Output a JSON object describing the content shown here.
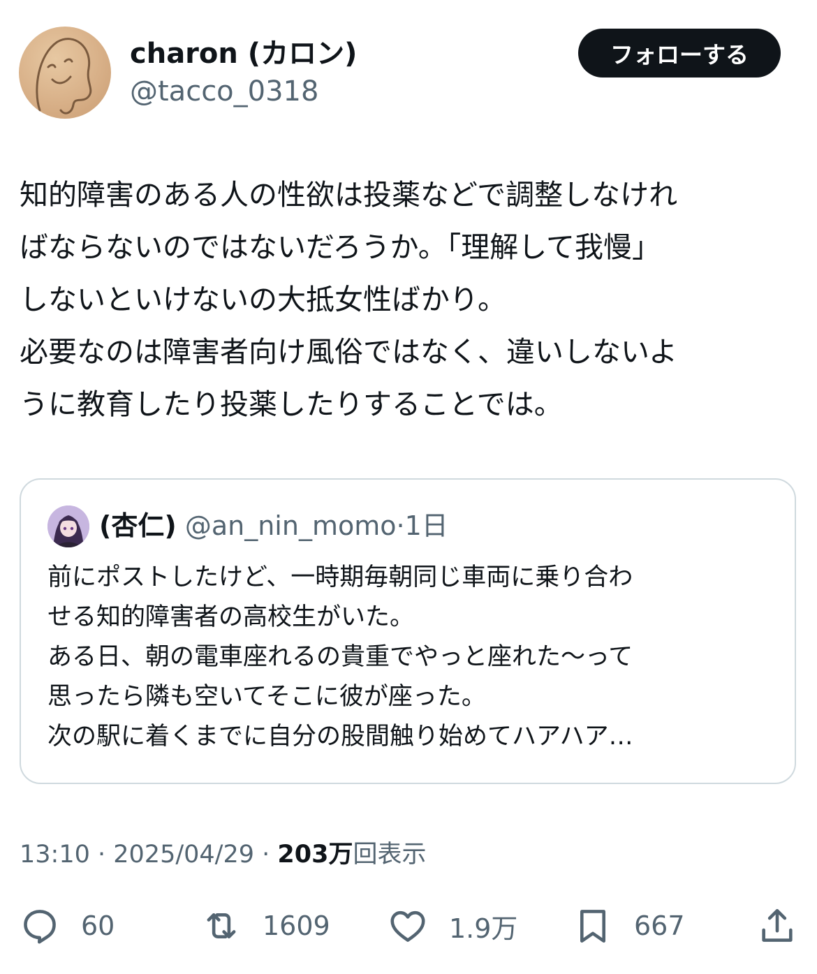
{
  "author": {
    "display_name": "charon (カロン)",
    "handle": "@tacco_0318",
    "avatar_icon": "ghost-drawing-avatar"
  },
  "follow_button": {
    "label": "フォローする"
  },
  "tweet": {
    "lines": [
      "知的障害のある人の性欲は投薬などで調整しなけれ",
      "ばならないのではないだろうか。「理解して我慢」",
      "しないといけないの大抵女性ばかり。",
      "必要なのは障害者向け風俗ではなく、違いしないよ",
      "うに教育したり投薬したりすることでは。"
    ]
  },
  "quote": {
    "name": "(杏仁)",
    "handle": "@an_nin_momo",
    "separator": "·",
    "time": "1日",
    "lines": [
      "前にポストしたけど、一時期毎朝同じ車両に乗り合わ",
      "せる知的障害者の高校生がいた。",
      "ある日、朝の電車座れるの貴重でやっと座れた〜って",
      "思ったら隣も空いてそこに彼が座った。",
      "次の駅に着くまでに自分の股間触り始めてハアハア…"
    ]
  },
  "meta": {
    "time": "13:10",
    "sep1": " · ",
    "date": "2025/04/29",
    "sep2": " · ",
    "views_count": "203万",
    "views_label": "回表示"
  },
  "actions": {
    "reply": {
      "icon": "reply-icon",
      "count": "60"
    },
    "retweet": {
      "icon": "retweet-icon",
      "count": "1609"
    },
    "like": {
      "icon": "heart-icon",
      "count": "1.9万"
    },
    "bookmark": {
      "icon": "bookmark-icon",
      "count": "667"
    },
    "share": {
      "icon": "share-icon"
    }
  },
  "colors": {
    "text": "#0f1419",
    "secondary": "#536471",
    "border": "#cfd9de",
    "button_bg": "#0f1419",
    "button_text": "#ffffff"
  }
}
